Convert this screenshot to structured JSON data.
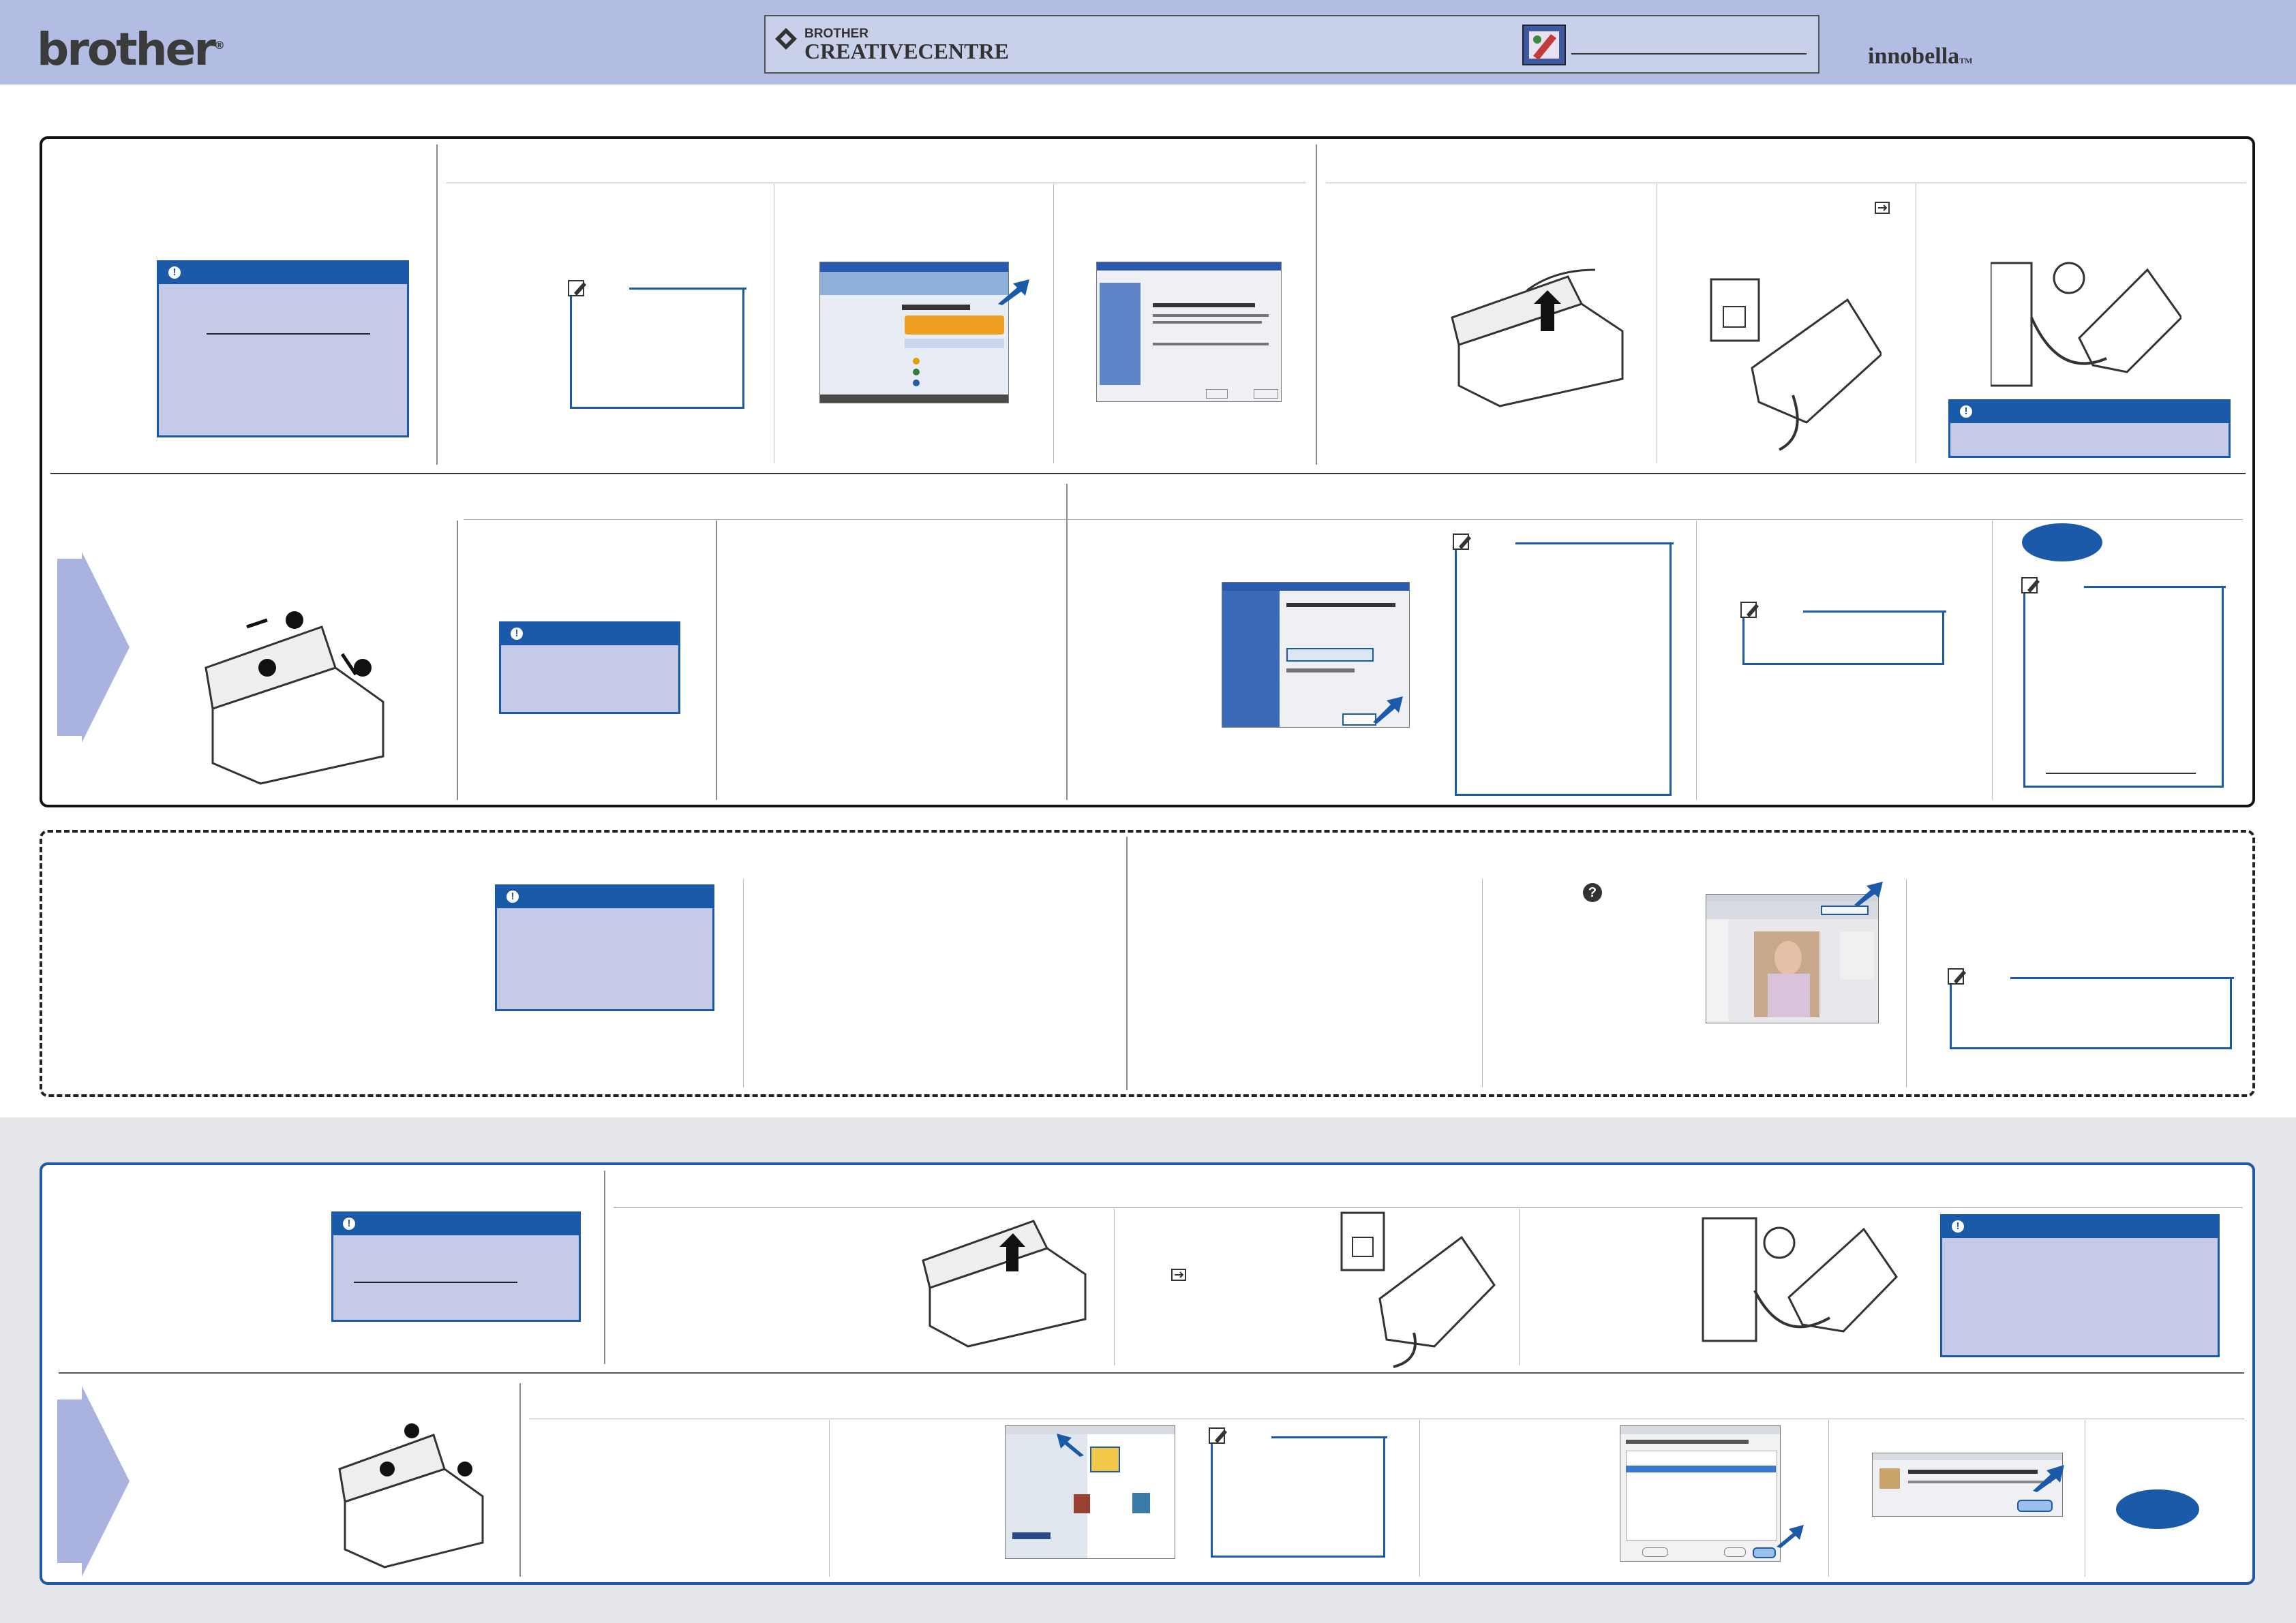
{
  "header": {
    "brand": "brother",
    "brand_mark": "®",
    "creative_line1": "BROTHER",
    "creative_line2": "CREATIVECENTRE",
    "product": "innobella",
    "product_mark": "TM"
  },
  "colors": {
    "header_band": "#b3bde3",
    "accent_blue": "#1b5aa8",
    "warning_fill": "#c5cbe7",
    "arrow_fill": "#aab3e0",
    "grey_zone": "#e5e6ea"
  },
  "icons": [
    "brother-diamond-icon",
    "creative-centre-icon",
    "warning-icon",
    "note-pencil-icon",
    "usb-icon",
    "help-icon",
    "blue-arrow-icon"
  ]
}
